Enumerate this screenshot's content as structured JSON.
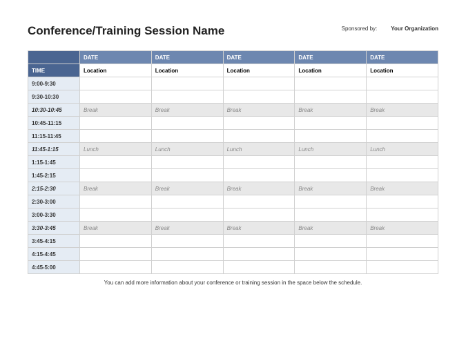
{
  "header": {
    "title": "Conference/Training Session Name",
    "sponsor_label": "Sponsored by:",
    "sponsor_org": "Your Organization"
  },
  "table": {
    "time_header": "TIME",
    "date_headers": [
      "DATE",
      "DATE",
      "DATE",
      "DATE",
      "DATE"
    ],
    "location_row_label": "",
    "locations": [
      "Location",
      "Location",
      "Location",
      "Location",
      "Location"
    ],
    "rows": [
      {
        "time": "9:00-9:30",
        "type": "normal",
        "cells": [
          "",
          "",
          "",
          "",
          ""
        ]
      },
      {
        "time": "9:30-10:30",
        "type": "normal",
        "cells": [
          "",
          "",
          "",
          "",
          ""
        ]
      },
      {
        "time": "10:30-10:45",
        "type": "break",
        "cells": [
          "Break",
          "Break",
          "Break",
          "Break",
          "Break"
        ]
      },
      {
        "time": "10:45-11:15",
        "type": "normal",
        "cells": [
          "",
          "",
          "",
          "",
          ""
        ]
      },
      {
        "time": "11:15-11:45",
        "type": "normal",
        "cells": [
          "",
          "",
          "",
          "",
          ""
        ]
      },
      {
        "time": "11:45-1:15",
        "type": "break",
        "cells": [
          "Lunch",
          "Lunch",
          "Lunch",
          "Lunch",
          "Lunch"
        ]
      },
      {
        "time": "1:15-1:45",
        "type": "normal",
        "cells": [
          "",
          "",
          "",
          "",
          ""
        ]
      },
      {
        "time": "1:45-2:15",
        "type": "normal",
        "cells": [
          "",
          "",
          "",
          "",
          ""
        ]
      },
      {
        "time": "2:15-2:30",
        "type": "break",
        "cells": [
          "Break",
          "Break",
          "Break",
          "Break",
          "Break"
        ]
      },
      {
        "time": "2:30-3:00",
        "type": "normal",
        "cells": [
          "",
          "",
          "",
          "",
          ""
        ]
      },
      {
        "time": "3:00-3:30",
        "type": "normal",
        "cells": [
          "",
          "",
          "",
          "",
          ""
        ]
      },
      {
        "time": "3:30-3:45",
        "type": "break",
        "cells": [
          "Break",
          "Break",
          "Break",
          "Break",
          "Break"
        ]
      },
      {
        "time": "3:45-4:15",
        "type": "normal",
        "cells": [
          "",
          "",
          "",
          "",
          ""
        ]
      },
      {
        "time": "4:15-4:45",
        "type": "normal",
        "cells": [
          "",
          "",
          "",
          "",
          ""
        ]
      },
      {
        "time": "4:45-5:00",
        "type": "normal",
        "cells": [
          "",
          "",
          "",
          "",
          ""
        ]
      }
    ]
  },
  "footnote": "You can add more information about your conference or training session in the space below the schedule."
}
